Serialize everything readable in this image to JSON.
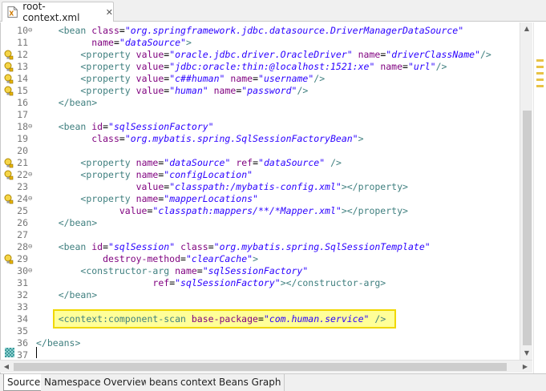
{
  "editor_tab": {
    "title": "root-context.xml",
    "close": "✕"
  },
  "icons": {
    "file": "xml-file-icon",
    "warning": "lightbulb-warning-icon",
    "fold": "collapse-icon"
  },
  "colors": {
    "tag": "#3f7f7f",
    "attr": "#7f007f",
    "value": "#2a00ff",
    "highlight_bg": "#ffff99",
    "highlight_border": "#f0d800"
  },
  "lines": [
    {
      "n": "10",
      "fold": true,
      "mark": false,
      "segs": [
        [
          "p",
          "    "
        ],
        [
          "t",
          "<bean "
        ],
        [
          "a",
          "class"
        ],
        [
          "p",
          "="
        ],
        [
          "v",
          "\"org.springframework.jdbc.datasource.DriverManagerDataSource\""
        ]
      ]
    },
    {
      "n": "11",
      "fold": false,
      "mark": false,
      "segs": [
        [
          "p",
          "          "
        ],
        [
          "a",
          "name"
        ],
        [
          "p",
          "="
        ],
        [
          "v",
          "\"dataSource\""
        ],
        [
          "t",
          ">"
        ]
      ]
    },
    {
      "n": "12",
      "fold": false,
      "mark": true,
      "segs": [
        [
          "p",
          "        "
        ],
        [
          "t",
          "<property "
        ],
        [
          "a",
          "value"
        ],
        [
          "p",
          "="
        ],
        [
          "v",
          "\"oracle.jdbc.driver.OracleDriver\""
        ],
        [
          "p",
          " "
        ],
        [
          "a",
          "name"
        ],
        [
          "p",
          "="
        ],
        [
          "v",
          "\"driverClassName\""
        ],
        [
          "t",
          "/>"
        ]
      ]
    },
    {
      "n": "13",
      "fold": false,
      "mark": true,
      "segs": [
        [
          "p",
          "        "
        ],
        [
          "t",
          "<property "
        ],
        [
          "a",
          "value"
        ],
        [
          "p",
          "="
        ],
        [
          "v",
          "\"jdbc:oracle:thin:@localhost:1521:xe\""
        ],
        [
          "p",
          " "
        ],
        [
          "a",
          "name"
        ],
        [
          "p",
          "="
        ],
        [
          "v",
          "\"url\""
        ],
        [
          "t",
          "/>"
        ]
      ]
    },
    {
      "n": "14",
      "fold": false,
      "mark": true,
      "segs": [
        [
          "p",
          "        "
        ],
        [
          "t",
          "<property "
        ],
        [
          "a",
          "value"
        ],
        [
          "p",
          "="
        ],
        [
          "v",
          "\"c##human\""
        ],
        [
          "p",
          " "
        ],
        [
          "a",
          "name"
        ],
        [
          "p",
          "="
        ],
        [
          "v",
          "\"username\""
        ],
        [
          "t",
          "/>"
        ]
      ]
    },
    {
      "n": "15",
      "fold": false,
      "mark": true,
      "segs": [
        [
          "p",
          "        "
        ],
        [
          "t",
          "<property "
        ],
        [
          "a",
          "value"
        ],
        [
          "p",
          "="
        ],
        [
          "v",
          "\"human\""
        ],
        [
          "p",
          " "
        ],
        [
          "a",
          "name"
        ],
        [
          "p",
          "="
        ],
        [
          "v",
          "\"password\""
        ],
        [
          "t",
          "/>"
        ]
      ]
    },
    {
      "n": "16",
      "fold": false,
      "mark": false,
      "segs": [
        [
          "p",
          "    "
        ],
        [
          "t",
          "</bean>"
        ]
      ]
    },
    {
      "n": "17",
      "fold": false,
      "mark": false,
      "segs": []
    },
    {
      "n": "18",
      "fold": true,
      "mark": false,
      "segs": [
        [
          "p",
          "    "
        ],
        [
          "t",
          "<bean "
        ],
        [
          "a",
          "id"
        ],
        [
          "p",
          "="
        ],
        [
          "v",
          "\"sqlSessionFactory\""
        ]
      ]
    },
    {
      "n": "19",
      "fold": false,
      "mark": false,
      "segs": [
        [
          "p",
          "          "
        ],
        [
          "a",
          "class"
        ],
        [
          "p",
          "="
        ],
        [
          "v",
          "\"org.mybatis.spring.SqlSessionFactoryBean\""
        ],
        [
          "t",
          ">"
        ]
      ]
    },
    {
      "n": "20",
      "fold": false,
      "mark": false,
      "segs": []
    },
    {
      "n": "21",
      "fold": false,
      "mark": true,
      "segs": [
        [
          "p",
          "        "
        ],
        [
          "t",
          "<property "
        ],
        [
          "a",
          "name"
        ],
        [
          "p",
          "="
        ],
        [
          "v",
          "\"dataSource\""
        ],
        [
          "p",
          " "
        ],
        [
          "a",
          "ref"
        ],
        [
          "p",
          "="
        ],
        [
          "v",
          "\"dataSource\""
        ],
        [
          "p",
          " "
        ],
        [
          "t",
          "/>"
        ]
      ]
    },
    {
      "n": "22",
      "fold": true,
      "mark": true,
      "segs": [
        [
          "p",
          "        "
        ],
        [
          "t",
          "<property "
        ],
        [
          "a",
          "name"
        ],
        [
          "p",
          "="
        ],
        [
          "v",
          "\"configLocation\""
        ]
      ]
    },
    {
      "n": "23",
      "fold": false,
      "mark": false,
      "segs": [
        [
          "p",
          "                  "
        ],
        [
          "a",
          "value"
        ],
        [
          "p",
          "="
        ],
        [
          "v",
          "\"classpath:/mybatis-config.xml\""
        ],
        [
          "t",
          "></property>"
        ]
      ]
    },
    {
      "n": "24",
      "fold": true,
      "mark": true,
      "segs": [
        [
          "p",
          "        "
        ],
        [
          "t",
          "<property "
        ],
        [
          "a",
          "name"
        ],
        [
          "p",
          "="
        ],
        [
          "v",
          "\"mapperLocations\""
        ]
      ]
    },
    {
      "n": "25",
      "fold": false,
      "mark": false,
      "segs": [
        [
          "p",
          "               "
        ],
        [
          "a",
          "value"
        ],
        [
          "p",
          "="
        ],
        [
          "v",
          "\"classpath:mappers/**/*Mapper.xml\""
        ],
        [
          "t",
          "></property>"
        ]
      ]
    },
    {
      "n": "26",
      "fold": false,
      "mark": false,
      "segs": [
        [
          "p",
          "    "
        ],
        [
          "t",
          "</bean>"
        ]
      ]
    },
    {
      "n": "27",
      "fold": false,
      "mark": false,
      "segs": []
    },
    {
      "n": "28",
      "fold": true,
      "mark": false,
      "segs": [
        [
          "p",
          "    "
        ],
        [
          "t",
          "<bean "
        ],
        [
          "a",
          "id"
        ],
        [
          "p",
          "="
        ],
        [
          "v",
          "\"sqlSession\""
        ],
        [
          "p",
          " "
        ],
        [
          "a",
          "class"
        ],
        [
          "p",
          "="
        ],
        [
          "v",
          "\"org.mybatis.spring.SqlSessionTemplate\""
        ]
      ]
    },
    {
      "n": "29",
      "fold": false,
      "mark": true,
      "segs": [
        [
          "p",
          "            "
        ],
        [
          "a",
          "destroy-method"
        ],
        [
          "p",
          "="
        ],
        [
          "v",
          "\"clearCache\""
        ],
        [
          "t",
          ">"
        ]
      ]
    },
    {
      "n": "30",
      "fold": true,
      "mark": false,
      "segs": [
        [
          "p",
          "        "
        ],
        [
          "t",
          "<constructor-arg "
        ],
        [
          "a",
          "name"
        ],
        [
          "p",
          "="
        ],
        [
          "v",
          "\"sqlSessionFactory\""
        ]
      ]
    },
    {
      "n": "31",
      "fold": false,
      "mark": false,
      "segs": [
        [
          "p",
          "                     "
        ],
        [
          "a",
          "ref"
        ],
        [
          "p",
          "="
        ],
        [
          "v",
          "\"sqlSessionFactory\""
        ],
        [
          "t",
          "></constructor-arg>"
        ]
      ]
    },
    {
      "n": "32",
      "fold": false,
      "mark": false,
      "segs": [
        [
          "p",
          "    "
        ],
        [
          "t",
          "</bean>"
        ]
      ]
    },
    {
      "n": "33",
      "fold": false,
      "mark": false,
      "segs": []
    },
    {
      "n": "34",
      "fold": false,
      "mark": false,
      "segs": [
        [
          "p",
          "    "
        ],
        [
          "t",
          "<context:component-scan "
        ],
        [
          "a",
          "base-package"
        ],
        [
          "p",
          "="
        ],
        [
          "v",
          "\"com.human.service\""
        ],
        [
          "p",
          " "
        ],
        [
          "t",
          "/>"
        ]
      ]
    },
    {
      "n": "35",
      "fold": false,
      "mark": false,
      "segs": []
    },
    {
      "n": "36",
      "fold": false,
      "mark": false,
      "segs": [
        [
          "t",
          "</beans>"
        ]
      ]
    },
    {
      "n": "37",
      "fold": false,
      "mark": false,
      "segs": []
    }
  ],
  "page_tabs": [
    {
      "label": "Source",
      "active": true
    },
    {
      "label": "Namespaces",
      "active": false
    },
    {
      "label": "Overview",
      "active": false
    },
    {
      "label": "beans",
      "active": false
    },
    {
      "label": "context",
      "active": false
    },
    {
      "label": "Beans Graph",
      "active": false
    }
  ]
}
